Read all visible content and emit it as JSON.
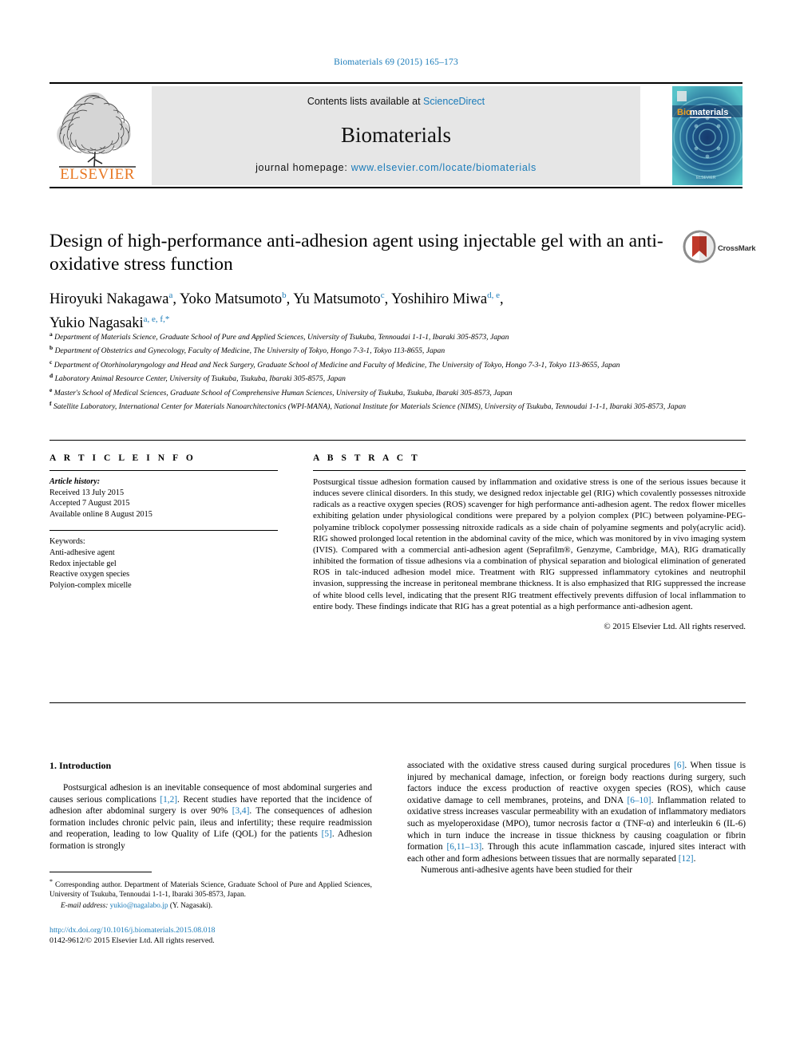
{
  "running_head": "Biomaterials 69 (2015) 165–173",
  "masthead": {
    "contents_prefix": "Contents lists available at ",
    "sciencedirect": "ScienceDirect",
    "journal_name": "Biomaterials",
    "homepage_prefix": "journal homepage: ",
    "homepage_url": "www.elsevier.com/locate/biomaterials",
    "publisher": "ELSEVIER",
    "cover_title": "Biomaterials",
    "accent_blue": "#1a7bb9",
    "elsevier_orange": "#e87722"
  },
  "article": {
    "title": "Design of high-performance anti-adhesion agent using injectable gel with an anti-oxidative stress function",
    "crossmark_label": "CrossMark",
    "authors": [
      {
        "name": "Hiroyuki Nakagawa",
        "sup": "a",
        "sep": ", "
      },
      {
        "name": "Yoko Matsumoto",
        "sup": "b",
        "sep": ", "
      },
      {
        "name": "Yu Matsumoto",
        "sup": "c",
        "sep": ", "
      },
      {
        "name": "Yoshihiro Miwa",
        "sup": "d, e",
        "sep": ", "
      },
      {
        "name": "Yukio Nagasaki",
        "sup": "a, e, f,",
        "sep": "",
        "star": "*"
      }
    ],
    "affiliations": [
      {
        "label": "a",
        "text": "Department of Materials Science, Graduate School of Pure and Applied Sciences, University of Tsukuba, Tennoudai 1-1-1, Ibaraki 305-8573, Japan"
      },
      {
        "label": "b",
        "text": "Department of Obstetrics and Gynecology, Faculty of Medicine, The University of Tokyo, Hongo 7-3-1, Tokyo 113-8655, Japan"
      },
      {
        "label": "c",
        "text": "Department of Otorhinolaryngology and Head and Neck Surgery, Graduate School of Medicine and Faculty of Medicine, The University of Tokyo, Hongo 7-3-1, Tokyo 113-8655, Japan"
      },
      {
        "label": "d",
        "text": "Laboratory Animal Resource Center, University of Tsukuba, Tsukuba, Ibaraki 305-8575, Japan"
      },
      {
        "label": "e",
        "text": "Master's School of Medical Sciences, Graduate School of Comprehensive Human Sciences, University of Tsukuba, Tsukuba, Ibaraki 305-8573, Japan"
      },
      {
        "label": "f",
        "text": "Satellite Laboratory, International Center for Materials Nanoarchitectonics (WPI-MANA), National Institute for Materials Science (NIMS), University of Tsukuba, Tennoudai 1-1-1, Ibaraki 305-8573, Japan"
      }
    ]
  },
  "article_info": {
    "heading": "A R T I C L E  I N F O",
    "history_label": "Article history:",
    "received": "Received 13 July 2015",
    "accepted": "Accepted 7 August 2015",
    "available": "Available online 8 August 2015",
    "keywords_label": "Keywords:",
    "keywords": [
      "Anti-adhesive agent",
      "Redox injectable gel",
      "Reactive oxygen species",
      "Polyion-complex micelle"
    ]
  },
  "abstract": {
    "heading": "A B S T R A C T",
    "text": "Postsurgical tissue adhesion formation caused by inflammation and oxidative stress is one of the serious issues because it induces severe clinical disorders. In this study, we designed redox injectable gel (RIG) which covalently possesses nitroxide radicals as a reactive oxygen species (ROS) scavenger for high performance anti-adhesion agent. The redox flower micelles exhibiting gelation under physiological conditions were prepared by a polyion complex (PIC) between polyamine-PEG-polyamine triblock copolymer possessing nitroxide radicals as a side chain of polyamine segments and poly(acrylic acid). RIG showed prolonged local retention in the abdominal cavity of the mice, which was monitored by in vivo imaging system (IVIS). Compared with a commercial anti-adhesion agent (Seprafilm®, Genzyme, Cambridge, MA), RIG dramatically inhibited the formation of tissue adhesions via a combination of physical separation and biological elimination of generated ROS in talc-induced adhesion model mice. Treatment with RIG suppressed inflammatory cytokines and neutrophil invasion, suppressing the increase in peritoneal membrane thickness. It is also emphasized that RIG suppressed the increase of white blood cells level, indicating that the present RIG treatment effectively prevents diffusion of local inflammation to entire body. These findings indicate that RIG has a great potential as a high performance anti-adhesion agent.",
    "copyright": "© 2015 Elsevier Ltd. All rights reserved."
  },
  "introduction": {
    "heading": "1. Introduction",
    "left_para_1": "Postsurgical adhesion is an inevitable consequence of most abdominal surgeries and causes serious complications ",
    "left_cite_1": "[1,2]",
    "left_para_2": ". Recent studies have reported that the incidence of adhesion after abdominal surgery is over 90% ",
    "left_cite_2": "[3,4]",
    "left_para_3": ". The consequences of adhesion formation includes chronic pelvic pain, ileus and infertility; these require readmission and reoperation, leading to low Quality of Life (QOL) for the patients ",
    "left_cite_3": "[5]",
    "left_para_4": ". Adhesion formation is strongly",
    "right_para_1": "associated with the oxidative stress caused during surgical procedures ",
    "right_cite_1": "[6]",
    "right_para_2": ". When tissue is injured by mechanical damage, infection, or foreign body reactions during surgery, such factors induce the excess production of reactive oxygen species (ROS), which cause oxidative damage to cell membranes, proteins, and DNA ",
    "right_cite_2": "[6–10]",
    "right_para_3": ". Inflammation related to oxidative stress increases vascular permeability with an exudation of inflammatory mediators such as myeloperoxidase (MPO), tumor necrosis factor α (TNF-α) and interleukin 6 (IL-6) which in turn induce the increase in tissue thickness by causing coagulation or fibrin formation ",
    "right_cite_3": "[6,11–13]",
    "right_para_4": ". Through this acute inflammation cascade, injured sites interact with each other and form adhesions between tissues that are normally separated ",
    "right_cite_4": "[12]",
    "right_para_5": ".",
    "right_para_6": "Numerous anti-adhesive agents have been studied for their"
  },
  "footer": {
    "corresponding_star": "*",
    "corresponding_text": " Corresponding author. Department of Materials Science, Graduate School of Pure and Applied Sciences, University of Tsukuba, Tennoudai 1-1-1, Ibaraki 305-8573, Japan.",
    "email_label": "E-mail address:",
    "email": "yukio@nagalabo.jp",
    "email_owner": " (Y. Nagasaki).",
    "doi": "http://dx.doi.org/10.1016/j.biomaterials.2015.08.018",
    "issn_line": "0142-9612/© 2015 Elsevier Ltd. All rights reserved."
  }
}
